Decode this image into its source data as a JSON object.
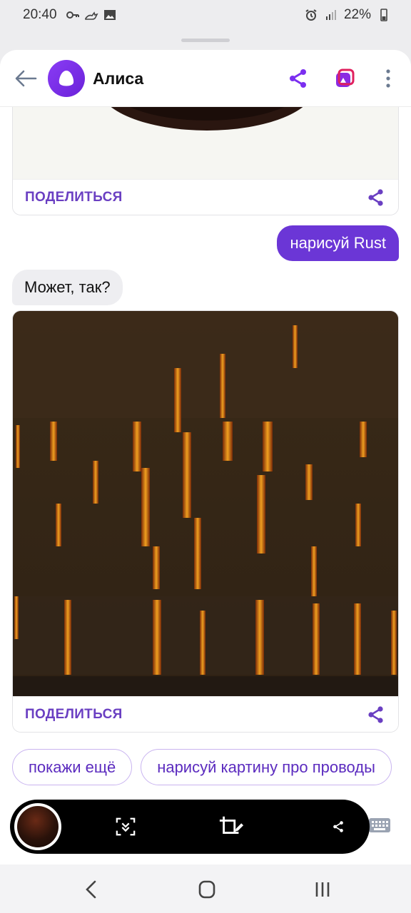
{
  "status_bar": {
    "time": "20:40",
    "battery": "22%",
    "icons_left": [
      "key-icon",
      "cat-icon",
      "image-icon"
    ],
    "icons_right": [
      "alarm-icon",
      "signal-icon",
      "battery-icon"
    ]
  },
  "header": {
    "title": "Алиса",
    "accent_color": "#7b2ff0"
  },
  "chat": {
    "card_top": {
      "share_label": "ПОДЕЛИТЬСЯ"
    },
    "user_message": "нарисуй Rust",
    "bot_message": "Может, так?",
    "card_main": {
      "share_label": "ПОДЕЛИТЬСЯ"
    }
  },
  "suggests": [
    {
      "label": "покажи ещё"
    },
    {
      "label": "нарисуй картину про проводы"
    }
  ],
  "toolbar": {
    "icons": [
      "scroll-capture-icon",
      "crop-edit-icon",
      "share-icon"
    ]
  },
  "nav": {
    "icons": [
      "back-nav-icon",
      "home-nav-icon",
      "recents-nav-icon"
    ]
  }
}
